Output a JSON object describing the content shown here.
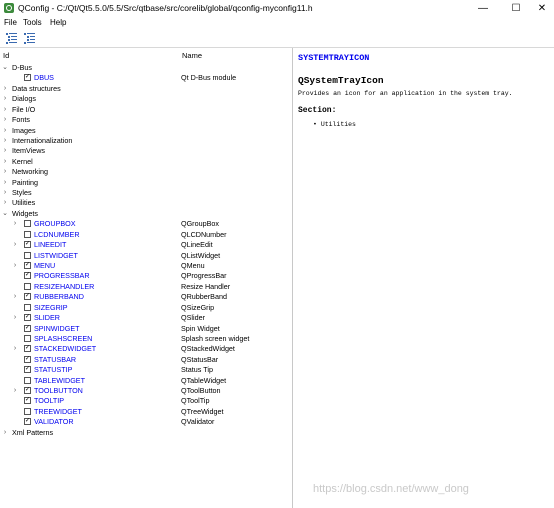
{
  "window": {
    "title": "QConfig - C:/Qt/Qt5.5.0/5.5/Src/qtbase/src/corelib/global/qconfig-myconfig11.h",
    "minimize": "—",
    "maximize": "☐",
    "close": "✕"
  },
  "menu": {
    "file": "File",
    "tools": "Tools",
    "help": "Help"
  },
  "tree": {
    "col_id": "Id",
    "col_name": "Name",
    "rows": [
      {
        "label": "D-Bus",
        "name": "",
        "arrow": "⌄",
        "checkbox": false,
        "checked": false,
        "link": false,
        "level": 0
      },
      {
        "label": "DBUS",
        "name": "Qt D-Bus module",
        "arrow": "",
        "checkbox": true,
        "checked": true,
        "link": true,
        "level": 1
      },
      {
        "label": "Data structures",
        "name": "",
        "arrow": "›",
        "checkbox": false,
        "checked": false,
        "link": false,
        "level": 0
      },
      {
        "label": "Dialogs",
        "name": "",
        "arrow": "›",
        "checkbox": false,
        "checked": false,
        "link": false,
        "level": 0
      },
      {
        "label": "File I/O",
        "name": "",
        "arrow": "›",
        "checkbox": false,
        "checked": false,
        "link": false,
        "level": 0
      },
      {
        "label": "Fonts",
        "name": "",
        "arrow": "›",
        "checkbox": false,
        "checked": false,
        "link": false,
        "level": 0
      },
      {
        "label": "Images",
        "name": "",
        "arrow": "›",
        "checkbox": false,
        "checked": false,
        "link": false,
        "level": 0
      },
      {
        "label": "Internationalization",
        "name": "",
        "arrow": "›",
        "checkbox": false,
        "checked": false,
        "link": false,
        "level": 0
      },
      {
        "label": "ItemViews",
        "name": "",
        "arrow": "›",
        "checkbox": false,
        "checked": false,
        "link": false,
        "level": 0
      },
      {
        "label": "Kernel",
        "name": "",
        "arrow": "›",
        "checkbox": false,
        "checked": false,
        "link": false,
        "level": 0
      },
      {
        "label": "Networking",
        "name": "",
        "arrow": "›",
        "checkbox": false,
        "checked": false,
        "link": false,
        "level": 0
      },
      {
        "label": "Painting",
        "name": "",
        "arrow": "›",
        "checkbox": false,
        "checked": false,
        "link": false,
        "level": 0
      },
      {
        "label": "Styles",
        "name": "",
        "arrow": "›",
        "checkbox": false,
        "checked": false,
        "link": false,
        "level": 0
      },
      {
        "label": "Utilities",
        "name": "",
        "arrow": "›",
        "checkbox": false,
        "checked": false,
        "link": false,
        "level": 0
      },
      {
        "label": "Widgets",
        "name": "",
        "arrow": "⌄",
        "checkbox": false,
        "checked": false,
        "link": false,
        "level": 0
      },
      {
        "label": "GROUPBOX",
        "name": "QGroupBox",
        "arrow": "›",
        "checkbox": true,
        "checked": false,
        "link": true,
        "level": 1
      },
      {
        "label": "LCDNUMBER",
        "name": "QLCDNumber",
        "arrow": "",
        "checkbox": true,
        "checked": false,
        "link": true,
        "level": 1
      },
      {
        "label": "LINEEDIT",
        "name": "QLineEdit",
        "arrow": "›",
        "checkbox": true,
        "checked": true,
        "link": true,
        "level": 1
      },
      {
        "label": "LISTWIDGET",
        "name": "QListWidget",
        "arrow": "",
        "checkbox": true,
        "checked": false,
        "link": true,
        "level": 1
      },
      {
        "label": "MENU",
        "name": "QMenu",
        "arrow": "›",
        "checkbox": true,
        "checked": true,
        "link": true,
        "level": 1
      },
      {
        "label": "PROGRESSBAR",
        "name": "QProgressBar",
        "arrow": "",
        "checkbox": true,
        "checked": true,
        "link": true,
        "level": 1
      },
      {
        "label": "RESIZEHANDLER",
        "name": "Resize Handler",
        "arrow": "",
        "checkbox": true,
        "checked": false,
        "link": true,
        "level": 1
      },
      {
        "label": "RUBBERBAND",
        "name": "QRubberBand",
        "arrow": "›",
        "checkbox": true,
        "checked": true,
        "link": true,
        "level": 1
      },
      {
        "label": "SIZEGRIP",
        "name": "QSizeGrip",
        "arrow": "",
        "checkbox": true,
        "checked": false,
        "link": true,
        "level": 1
      },
      {
        "label": "SLIDER",
        "name": "QSlider",
        "arrow": "›",
        "checkbox": true,
        "checked": true,
        "link": true,
        "level": 1
      },
      {
        "label": "SPINWIDGET",
        "name": "Spin Widget",
        "arrow": "",
        "checkbox": true,
        "checked": true,
        "link": true,
        "level": 1
      },
      {
        "label": "SPLASHSCREEN",
        "name": "Splash screen widget",
        "arrow": "",
        "checkbox": true,
        "checked": false,
        "link": true,
        "level": 1
      },
      {
        "label": "STACKEDWIDGET",
        "name": "QStackedWidget",
        "arrow": "›",
        "checkbox": true,
        "checked": true,
        "link": true,
        "level": 1
      },
      {
        "label": "STATUSBAR",
        "name": "QStatusBar",
        "arrow": "",
        "checkbox": true,
        "checked": true,
        "link": true,
        "level": 1
      },
      {
        "label": "STATUSTIP",
        "name": "Status Tip",
        "arrow": "",
        "checkbox": true,
        "checked": true,
        "link": true,
        "level": 1
      },
      {
        "label": "TABLEWIDGET",
        "name": "QTableWidget",
        "arrow": "",
        "checkbox": true,
        "checked": false,
        "link": true,
        "level": 1
      },
      {
        "label": "TOOLBUTTON",
        "name": "QToolButton",
        "arrow": "›",
        "checkbox": true,
        "checked": true,
        "link": true,
        "level": 1
      },
      {
        "label": "TOOLTIP",
        "name": "QToolTip",
        "arrow": "",
        "checkbox": true,
        "checked": true,
        "link": true,
        "level": 1
      },
      {
        "label": "TREEWIDGET",
        "name": "QTreeWidget",
        "arrow": "",
        "checkbox": true,
        "checked": false,
        "link": true,
        "level": 1
      },
      {
        "label": "VALIDATOR",
        "name": "QValidator",
        "arrow": "",
        "checkbox": true,
        "checked": true,
        "link": true,
        "level": 1
      },
      {
        "label": "Xml Patterns",
        "name": "",
        "arrow": "›",
        "checkbox": false,
        "checked": false,
        "link": false,
        "level": 0
      }
    ]
  },
  "doc": {
    "link": "SYSTEMTRAYICON",
    "title": "QSystemTrayIcon",
    "description": "Provides an icon for an application in the system tray.",
    "section": "Section:",
    "bullet": "Utilities"
  },
  "watermark": "https://blog.csdn.net/www_dong",
  "colors": {
    "link": "#0000ee",
    "icon": "#3a6ab0"
  }
}
